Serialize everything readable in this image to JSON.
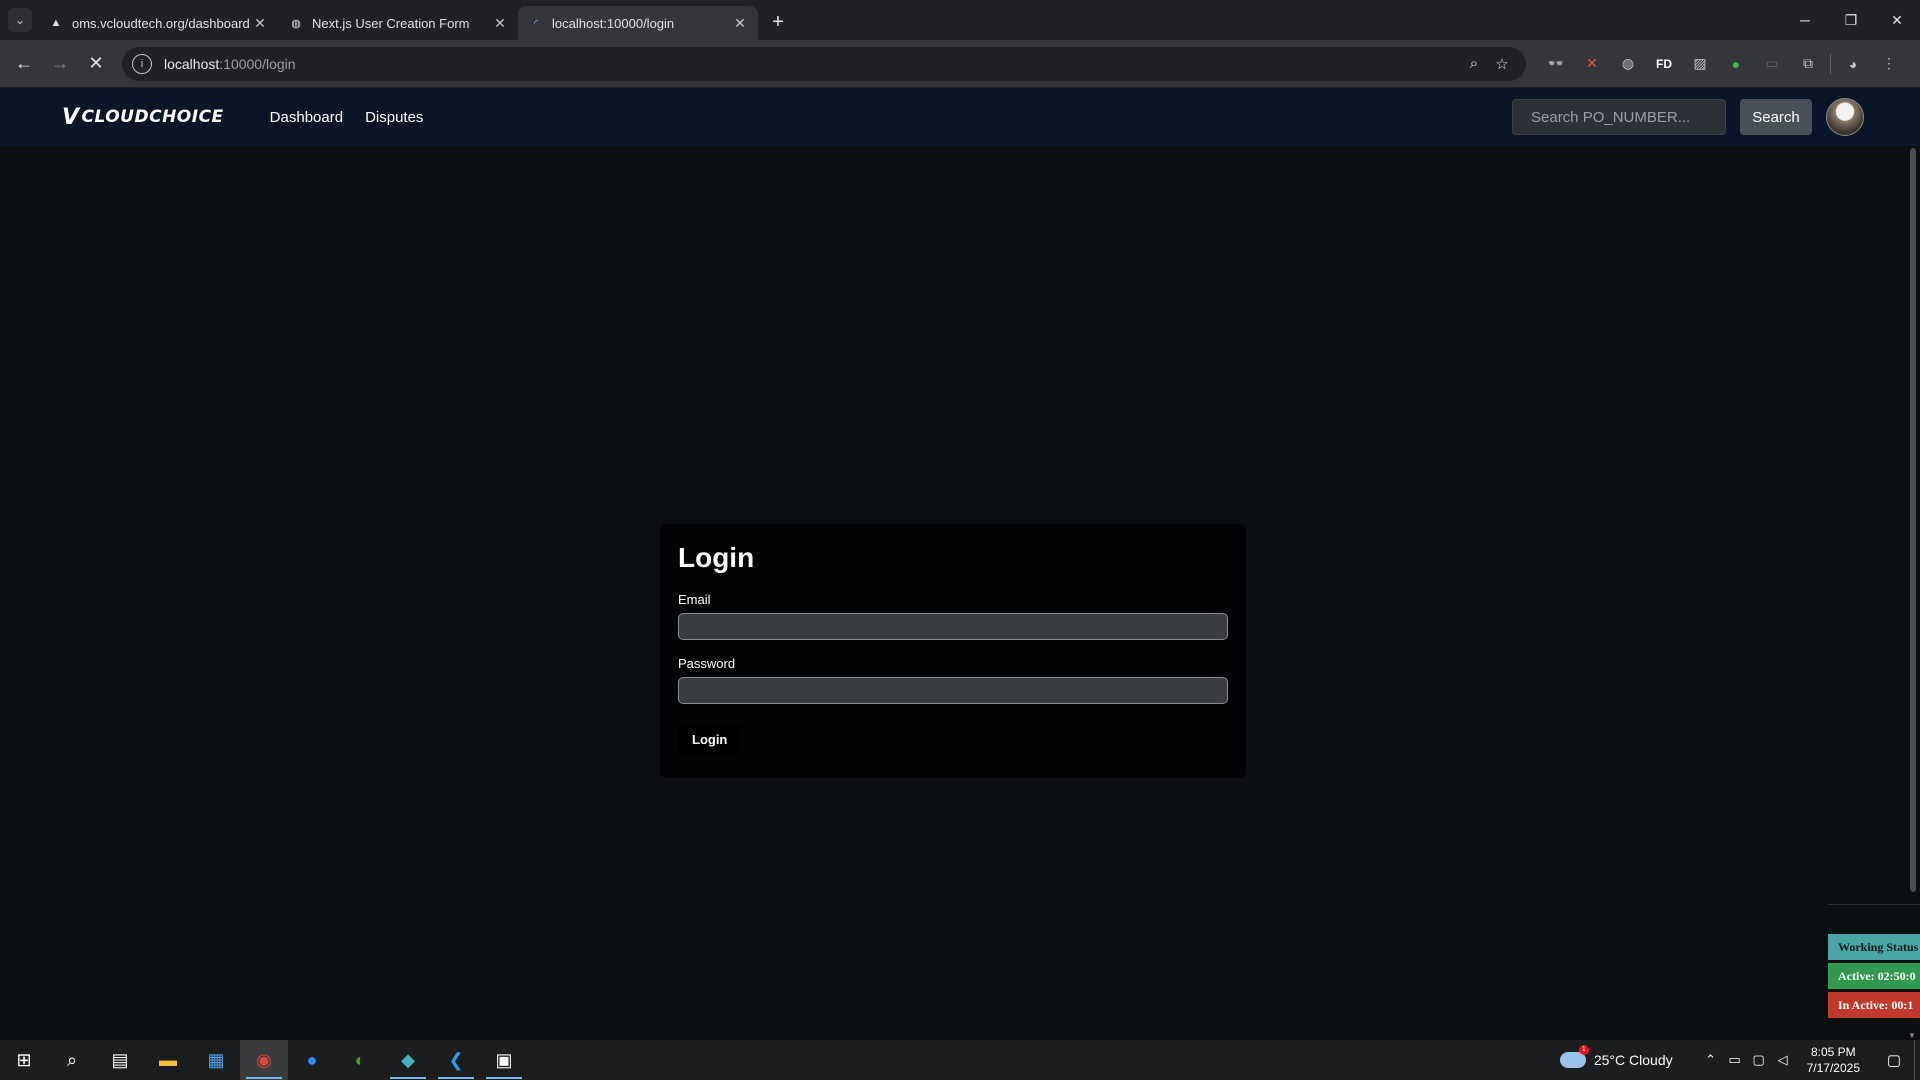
{
  "browser": {
    "tabs": [
      {
        "title": "oms.vcloudtech.org/dashboard",
        "favicon": "A",
        "active": false
      },
      {
        "title": "Next.js User Creation Form",
        "favicon": "globe",
        "active": false
      },
      {
        "title": "localhost:10000/login",
        "favicon": "loading",
        "active": true
      }
    ],
    "url_host": "localhost",
    "url_path": ":10000/login"
  },
  "header": {
    "logo_mark": "V",
    "logo_text": "CLOUDCHOICE",
    "nav": [
      "Dashboard",
      "Disputes"
    ],
    "search_placeholder": "Search PO_NUMBER...",
    "search_button": "Search"
  },
  "login": {
    "title": "Login",
    "email_label": "Email",
    "password_label": "Password",
    "button": "Login"
  },
  "status_widget": {
    "working_status": "Working Status",
    "active": "Active: 02:50:0",
    "inactive": "In Active: 00:1"
  },
  "taskbar": {
    "weather": "25°C  Cloudy",
    "time": "8:05 PM",
    "date": "7/17/2025"
  }
}
